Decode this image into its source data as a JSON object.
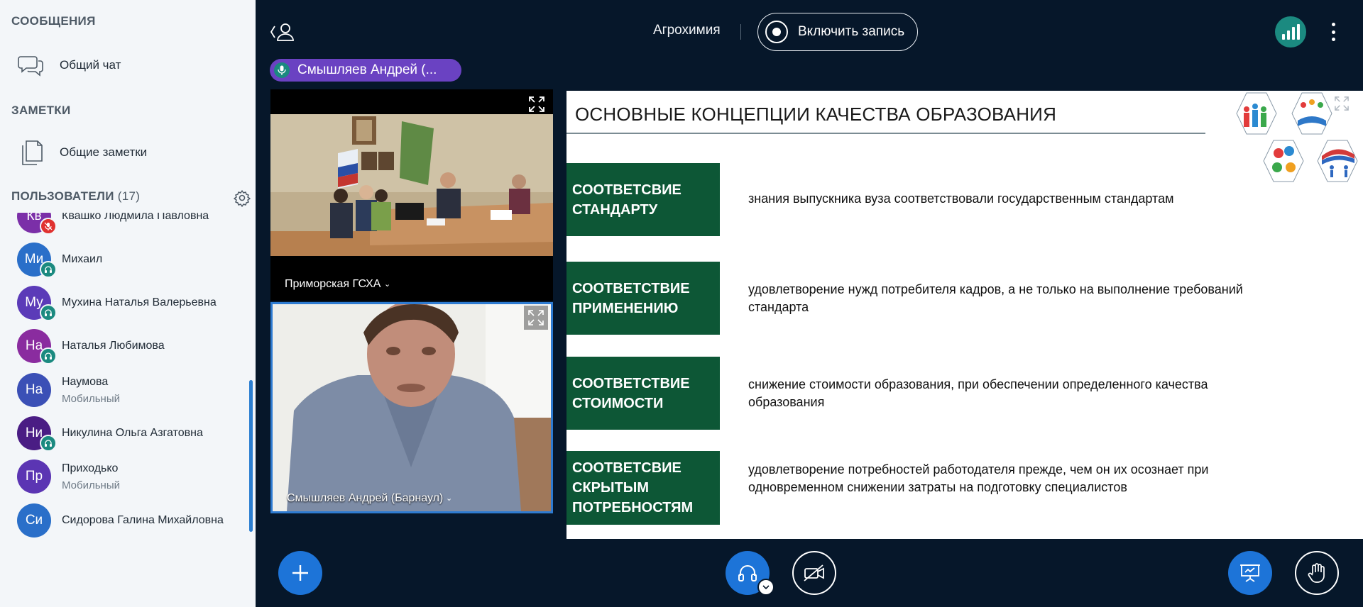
{
  "sidebar": {
    "messages_title": "СООБЩЕНИЯ",
    "public_chat": "Общий чат",
    "notes_title": "ЗАМЕТКИ",
    "shared_notes": "Общие заметки",
    "users_title": "ПОЛЬЗОВАТЕЛИ",
    "users_count": "(17)",
    "users": [
      {
        "initials": "Кв",
        "name": "Квашко Людмила Павловна",
        "sub": "",
        "color": "#7b2fa8",
        "status": "mic-muted"
      },
      {
        "initials": "Ми",
        "name": "Михаил",
        "sub": "",
        "color": "#2a6fc9",
        "status": "listen-only"
      },
      {
        "initials": "Му",
        "name": "Мухина Наталья Валерьевна",
        "sub": "",
        "color": "#5b3bb8",
        "status": "listen-only"
      },
      {
        "initials": "На",
        "name": "Наталья Любимова",
        "sub": "",
        "color": "#8a2c9f",
        "status": "listen-only"
      },
      {
        "initials": "На",
        "name": "Наумова",
        "sub": "Мобильный",
        "color": "#3b50b6",
        "status": "none"
      },
      {
        "initials": "Ни",
        "name": "Никулина Ольга Азгатовна",
        "sub": "",
        "color": "#4a1d84",
        "status": "listen-only"
      },
      {
        "initials": "Пр",
        "name": "Приходько",
        "sub": "Мобильный",
        "color": "#5b35b3",
        "status": "none"
      },
      {
        "initials": "Си",
        "name": "Сидорова Галина Михайловна",
        "sub": "",
        "color": "#2a6fc9",
        "status": "none"
      }
    ]
  },
  "topbar": {
    "meeting_title": "Агрохимия",
    "record_label": "Включить запись"
  },
  "talker": "Смышляев Андрей (...",
  "videos": [
    {
      "name": "Приморская ГСХА"
    },
    {
      "name": "Смышляев Андрей (Барнаул)"
    }
  ],
  "slide": {
    "title": "ОСНОВНЫЕ КОНЦЕПЦИИ КАЧЕСТВА ОБРАЗОВАНИЯ",
    "concepts": [
      {
        "lines": [
          "СООТВЕТСВИЕ",
          "СТАНДАРТУ"
        ],
        "desc": "знания выпускника вуза соответствовали государственным стандартам"
      },
      {
        "lines": [
          "СООТВЕТСТВИЕ",
          "ПРИМЕНЕНИЮ"
        ],
        "desc": "удовлетворение нужд потребителя кадров, а не только на выполнение требований стандарта"
      },
      {
        "lines": [
          "СООТВЕТСТВИЕ",
          "СТОИМОСТИ"
        ],
        "desc": "снижение стоимости образования, при обеспечении определенного качества образования"
      },
      {
        "lines": [
          "СООТВЕТСВИЕ",
          "СКРЫТЫМ",
          "ПОТРЕБНОСТЯМ"
        ],
        "desc": "удовлетворение  потребностей работодателя прежде, чем он их осознает при одновременном снижении затраты на подготовку специалистов"
      }
    ]
  },
  "colors": {
    "accent_blue": "#1d74d8",
    "concept_green": "#0d5736",
    "talker_purple": "#6a42c2",
    "status_teal": "#1b8a80",
    "muted_red": "#e0312f"
  }
}
